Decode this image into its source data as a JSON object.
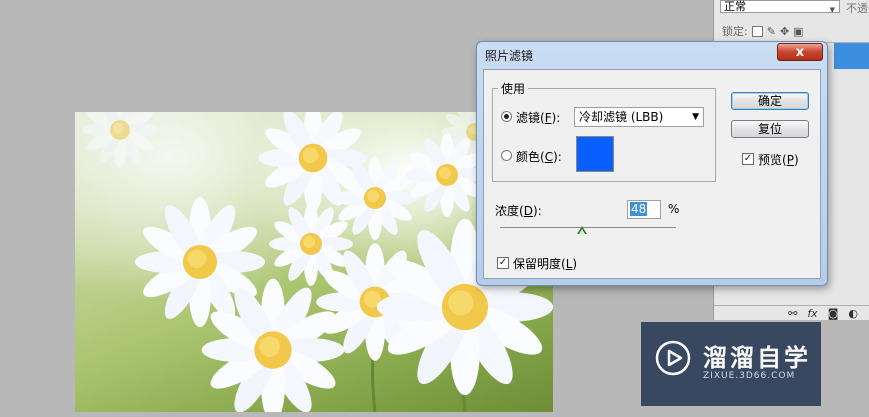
{
  "layers_panel": {
    "blend_mode": "正常",
    "opacity_label_fragment": "不透",
    "lock_label": "锁定:"
  },
  "dialog": {
    "title": "照片滤镜",
    "close_glyph": "x",
    "use_group": {
      "legend": "使用",
      "filter_option": {
        "label": "滤镜(",
        "mnemonic": "F",
        "suffix": "):",
        "selected": true
      },
      "filter_select_value": "冷却滤镜 (LBB)",
      "color_option": {
        "label": "颜色(",
        "mnemonic": "C",
        "suffix": "):",
        "selected": false
      },
      "swatch_color": "#0a5fff"
    },
    "density": {
      "label": "浓度(",
      "mnemonic": "D",
      "suffix": "):",
      "value": "48",
      "unit": "%",
      "slider_fraction": 0.48
    },
    "preserve_luminosity": {
      "label": "保留明度(",
      "mnemonic": "L",
      "suffix": ")",
      "checked": true
    },
    "buttons": {
      "ok": "确定",
      "reset": "复位"
    },
    "preview": {
      "label": "预览(",
      "mnemonic": "P",
      "suffix": ")",
      "checked": true
    }
  },
  "watermark": {
    "title": "溜溜自学",
    "subtitle": "ZIXUE.3D66.COM"
  },
  "colors": {
    "dialog_frame": "#b9cfe9",
    "close_button": "#c8452f",
    "selected_layer": "#3b8ee0",
    "watermark_bg": "#2f3f5a"
  }
}
